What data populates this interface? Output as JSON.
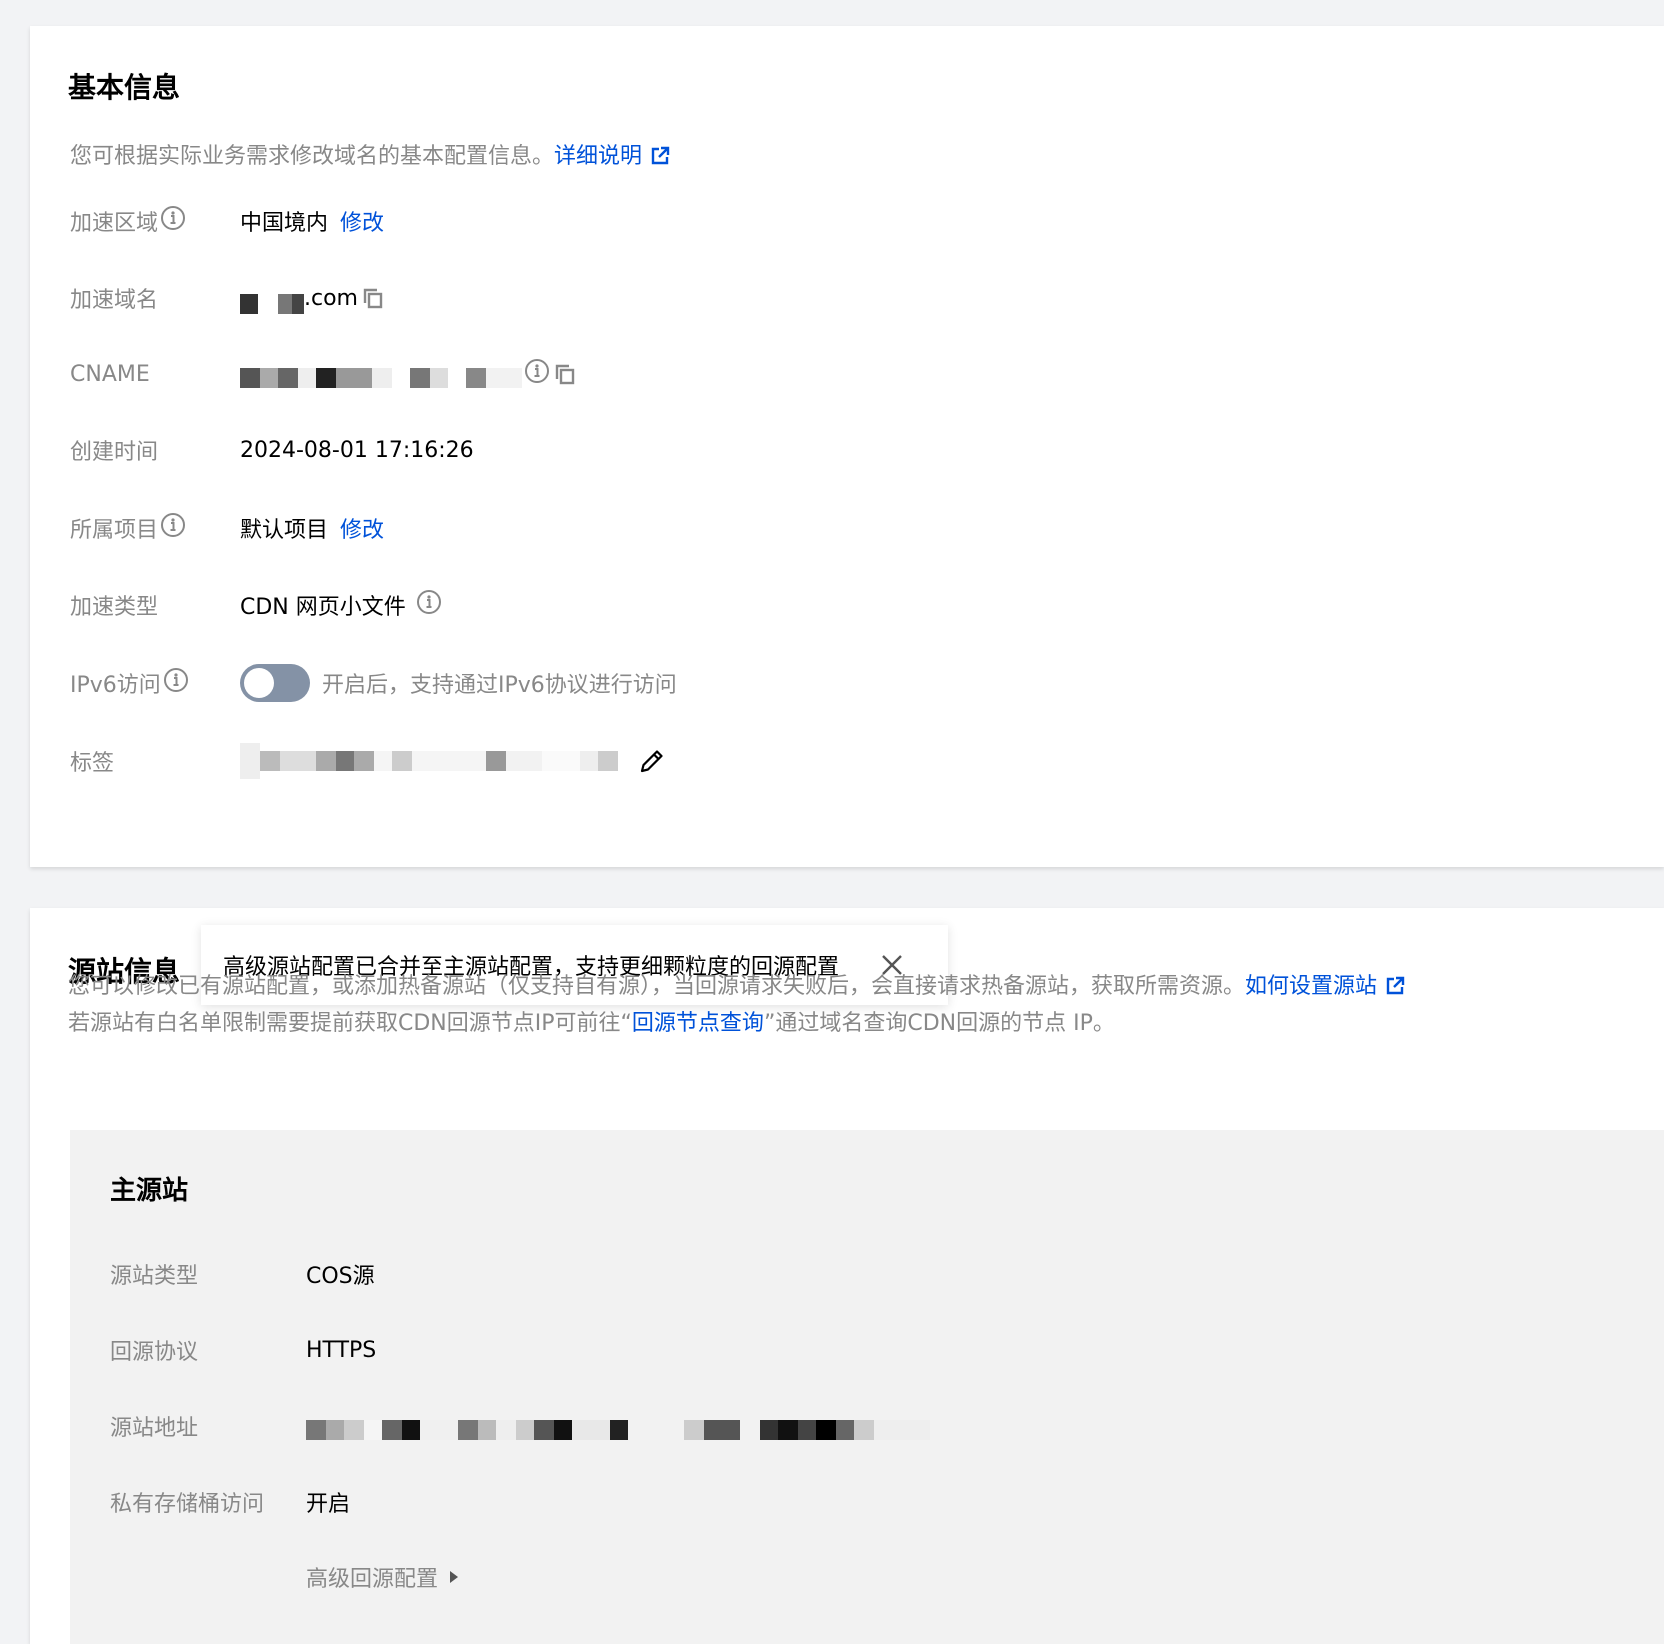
{
  "basic": {
    "title": "基本信息",
    "description": "您可根据实际业务需求修改域名的基本配置信息。",
    "detail_link": "详细说明",
    "rows": {
      "region": {
        "label": "加速区域",
        "value": "中国境内",
        "action": "修改"
      },
      "domain": {
        "label": "加速域名",
        "suffix": ".com"
      },
      "cname": {
        "label": "CNAME"
      },
      "created": {
        "label": "创建时间",
        "value": "2024-08-01 17:16:26"
      },
      "project": {
        "label": "所属项目",
        "value": "默认项目",
        "action": "修改"
      },
      "type": {
        "label": "加速类型",
        "value": "CDN 网页小文件"
      },
      "ipv6": {
        "label": "IPv6访问",
        "enabled": false,
        "hint": "开启后，支持通过IPv6协议进行访问"
      },
      "tags": {
        "label": "标签"
      }
    }
  },
  "origin": {
    "title": "源站信息",
    "tooltip": "高级源站配置已合并至主源站配置，支持更细颗粒度的回源配置",
    "description_line1": "您可以修改已有源站配置，或添加热备源站（仅支持自有源），当回源请求失败后，会直接请求热备源站，获取所需资源。",
    "how_link": "如何设置源站",
    "description_line2_prefix": "若源站有白名单限制需要提前获取CDN回源节点IP可前往“",
    "query_link": "回源节点查询",
    "description_line2_suffix": "”通过域名查询CDN回源的节点 IP。",
    "primary": {
      "title": "主源站",
      "rows": {
        "type": {
          "label": "源站类型",
          "value": "COS源"
        },
        "protocol": {
          "label": "回源协议",
          "value": "HTTPS"
        },
        "address": {
          "label": "源站地址"
        },
        "private": {
          "label": "私有存储桶访问",
          "value": "开启"
        }
      },
      "advanced": "高级回源配置"
    }
  },
  "colors": {
    "link": "#0052d9",
    "muted": "#888888",
    "toggle_off": "#8492a6"
  }
}
